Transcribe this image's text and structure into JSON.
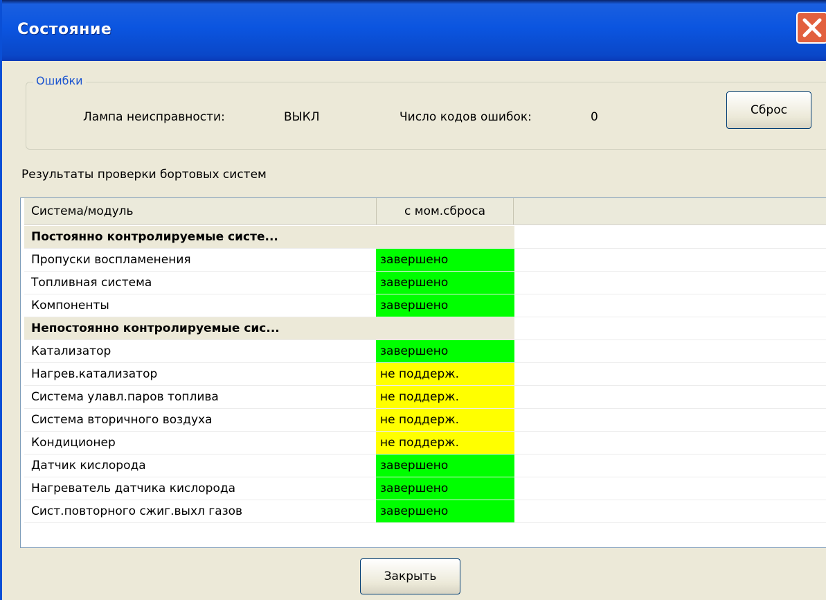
{
  "window": {
    "title": "Состояние"
  },
  "errors": {
    "legend": "Ошибки",
    "lamp_label": "Лампа неисправности:",
    "lamp_value": "ВЫКЛ",
    "codes_label": "Число кодов ошибок:",
    "codes_value": "0",
    "reset_label": "Сброс"
  },
  "results": {
    "label": "Результаты проверки бортовых систем",
    "columns": [
      "Система/модуль",
      "с мом.сброса"
    ],
    "rows": [
      {
        "name": "Постоянно контролируемые систе...",
        "status": "",
        "group": true
      },
      {
        "name": "Пропуски воспламенения",
        "status": "завершено",
        "state": "ok"
      },
      {
        "name": "Топливная система",
        "status": "завершено",
        "state": "ok"
      },
      {
        "name": "Компоненты",
        "status": "завершено",
        "state": "ok"
      },
      {
        "name": "Непостоянно контролируемые сис...",
        "status": "",
        "group": true
      },
      {
        "name": "Катализатор",
        "status": "завершено",
        "state": "ok"
      },
      {
        "name": "Нагрев.катализатор",
        "status": "не поддерж.",
        "state": "na"
      },
      {
        "name": "Система улавл.паров топлива",
        "status": "не поддерж.",
        "state": "na"
      },
      {
        "name": "Система вторичного воздуха",
        "status": "не поддерж.",
        "state": "na"
      },
      {
        "name": "Кондиционер",
        "status": "не поддерж.",
        "state": "na"
      },
      {
        "name": "Датчик кислорода",
        "status": "завершено",
        "state": "ok"
      },
      {
        "name": "Нагреватель датчика кислорода",
        "status": "завершено",
        "state": "ok"
      },
      {
        "name": "Сист.повторного сжиг.выхл газов",
        "status": "завершено",
        "state": "ok"
      }
    ]
  },
  "footer": {
    "close_label": "Закрыть"
  },
  "colors": {
    "ok": "#00ff00",
    "not_supported": "#ffff00",
    "titlebar": "#0b55e0"
  },
  "icons": {
    "close": "close-icon"
  }
}
